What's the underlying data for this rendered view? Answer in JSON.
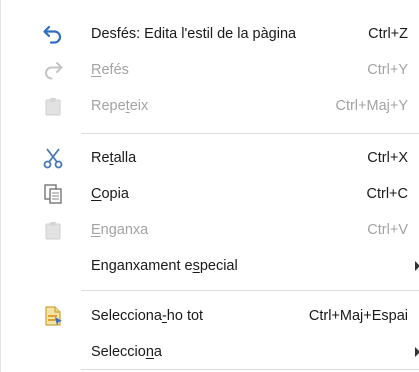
{
  "menu": {
    "undo": {
      "pre": "Desfés: Edita l'estil de la pàgina",
      "ul": "",
      "post": "",
      "shortcut": "Ctrl+Z",
      "icon": "undo-icon"
    },
    "redo": {
      "pre": "",
      "ul": "R",
      "post": "efés",
      "shortcut": "Ctrl+Y",
      "icon": "redo-icon"
    },
    "repeat": {
      "pre": "Repe",
      "ul": "t",
      "post": "eix",
      "shortcut": "Ctrl+Maj+Y",
      "icon": "repeat-icon"
    },
    "cut": {
      "pre": "Re",
      "ul": "t",
      "post": "alla",
      "shortcut": "Ctrl+X",
      "icon": "scissors-icon"
    },
    "copy": {
      "pre": "",
      "ul": "C",
      "post": "opia",
      "shortcut": "Ctrl+C",
      "icon": "copy-icon"
    },
    "paste": {
      "pre": "",
      "ul": "E",
      "post": "nganxa",
      "shortcut": "Ctrl+V",
      "icon": "paste-icon"
    },
    "paste_special": {
      "pre": "Enganxament e",
      "ul": "s",
      "post": "pecial",
      "shortcut": ""
    },
    "select_all": {
      "pre": "Selecciona",
      "ul": "-",
      "post": "ho tot",
      "shortcut": "Ctrl+Maj+Espai",
      "icon": "select-all-icon"
    },
    "select": {
      "pre": "Seleccio",
      "ul": "n",
      "post": "a",
      "shortcut": ""
    }
  },
  "colors": {
    "undo_blue": "#2f6fbf",
    "disabled_text": "#a3a3a3",
    "separator": "#dcdcdc"
  }
}
